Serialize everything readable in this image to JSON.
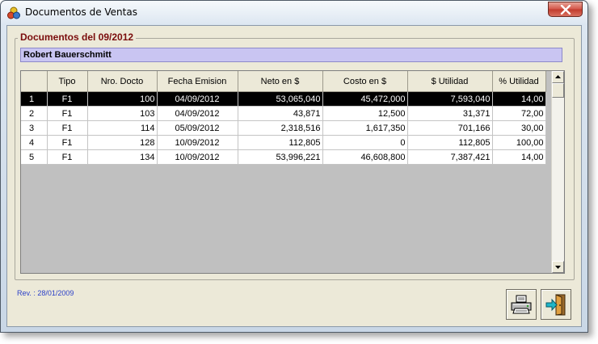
{
  "window": {
    "title": "Documentos de Ventas"
  },
  "group": {
    "legend": "Documentos del 09/2012"
  },
  "customer": {
    "name": "Robert Bauerschmitt"
  },
  "grid": {
    "columns": [
      "",
      "Tipo",
      "Nro. Docto",
      "Fecha Emision",
      "Neto en $",
      "Costo en $",
      "$ Utilidad",
      "% Utilidad"
    ],
    "rows": [
      [
        "1",
        "F1",
        "100",
        "04/09/2012",
        "53,065,040",
        "45,472,000",
        "7,593,040",
        "14,00"
      ],
      [
        "2",
        "F1",
        "103",
        "04/09/2012",
        "43,871",
        "12,500",
        "31,371",
        "72,00"
      ],
      [
        "3",
        "F1",
        "114",
        "05/09/2012",
        "2,318,516",
        "1,617,350",
        "701,166",
        "30,00"
      ],
      [
        "4",
        "F1",
        "128",
        "10/09/2012",
        "112,805",
        "0",
        "112,805",
        "100,00"
      ],
      [
        "5",
        "F1",
        "134",
        "10/09/2012",
        "53,996,221",
        "46,608,800",
        "7,387,421",
        "14,00"
      ]
    ],
    "selected_row": 0
  },
  "footer": {
    "revision": "Rev. : 28/01/2009"
  },
  "icons": {
    "window": "app-icon",
    "close": "close-icon",
    "print": "printer-icon",
    "exit": "exit-door-icon"
  },
  "colors": {
    "legend": "#7a0c0c",
    "customer_bar": "#c9c5f2",
    "selected_row": "#000000",
    "revision": "#2a3fc8"
  }
}
